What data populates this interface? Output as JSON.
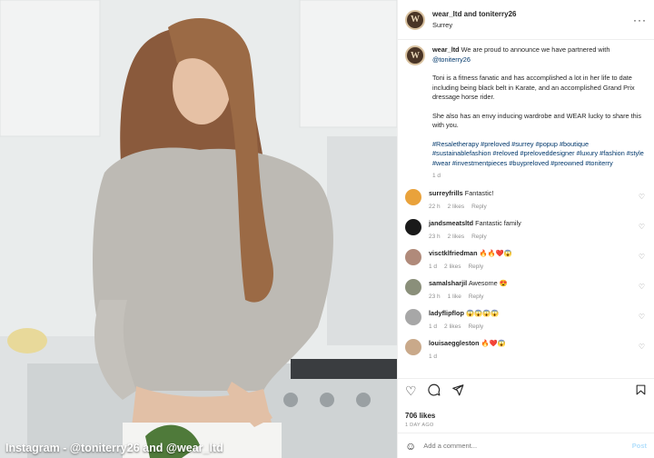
{
  "photo": {
    "credit": "Instagram - @toniterry26 and @wear_ltd"
  },
  "header": {
    "avatar_letter": "W",
    "who": "wear_ltd and toniterry26",
    "location": "Surrey",
    "more": "···"
  },
  "caption": {
    "username": "wear_ltd",
    "line1": "We are proud to announce we have partnered with",
    "mention": "@toniterry26",
    "para2": "Toni is a fitness fanatic and has accomplished a lot in her life to date including being black belt in Karate, and an accomplished Grand Prix dressage horse rider.",
    "para3": "She also has an envy inducing wardrobe and WEAR lucky to share this with you.",
    "hashtags": "#Resaletherapy #preloved #surrey #popup #boutique #sustainablefashion #reloved #preloveddesigner #luxury #fashion #style #wear #investmentpieces #buypreloved #preowned #toniterry",
    "age": "1 d"
  },
  "comments": [
    {
      "user": "surreyfrills",
      "text": "Fantastic!",
      "age": "22 h",
      "likes": "2 likes",
      "reply": "Reply",
      "color": "#e9a23b"
    },
    {
      "user": "jandsmeatsltd",
      "text": "Fantastic family",
      "age": "23 h",
      "likes": "2 likes",
      "reply": "Reply",
      "color": "#1a1a1a"
    },
    {
      "user": "visctklfriedman",
      "text": "🔥🔥❤️😱",
      "age": "1 d",
      "likes": "2 likes",
      "reply": "Reply",
      "color": "#b08a7a"
    },
    {
      "user": "samalsharjil",
      "text": "Awesome 😍",
      "age": "23 h",
      "likes": "1 like",
      "reply": "Reply",
      "color": "#8a8f7a"
    },
    {
      "user": "ladyflipflop",
      "text": "😱😱😱😱",
      "age": "1 d",
      "likes": "2 likes",
      "reply": "Reply",
      "color": "#a7a7a7"
    },
    {
      "user": "louisaeggleston",
      "text": "🔥❤️😱",
      "age": "1 d",
      "likes": "",
      "reply": "",
      "color": "#c9a98a"
    }
  ],
  "icons": {
    "like": "heart-icon",
    "comment": "comment-icon",
    "share": "share-icon",
    "save": "bookmark-icon",
    "emoji": "emoji-icon",
    "comment_like": "small-heart-icon"
  },
  "likes": "706 likes",
  "date": "1 DAY AGO",
  "add_comment": {
    "placeholder": "Add a comment...",
    "post": "Post"
  },
  "colors": {
    "link": "#00376b",
    "muted": "#8e8e8e",
    "post_disabled": "#b2dffc"
  }
}
